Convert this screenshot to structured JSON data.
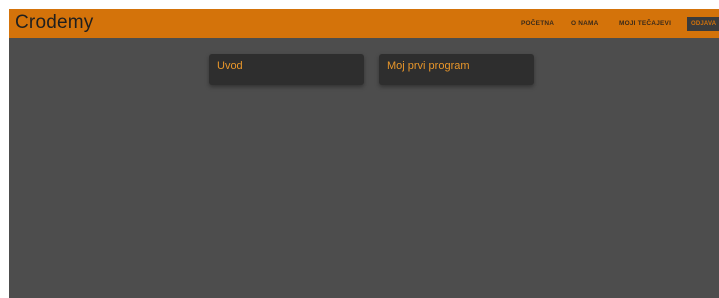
{
  "brand": {
    "name": "Crodemy"
  },
  "nav": {
    "home_label": "POČETNA",
    "about_label": "O NAMA",
    "courses_label": "MOJI TEČAJEVI",
    "logout_label": "ODJAVA"
  },
  "courses": [
    {
      "title": "Uvod"
    },
    {
      "title": "Moj prvi program"
    }
  ],
  "colors": {
    "accent": "#d4730a",
    "background": "#4d4d4d",
    "card": "#2e2e2e",
    "card_text": "#e8962a"
  }
}
